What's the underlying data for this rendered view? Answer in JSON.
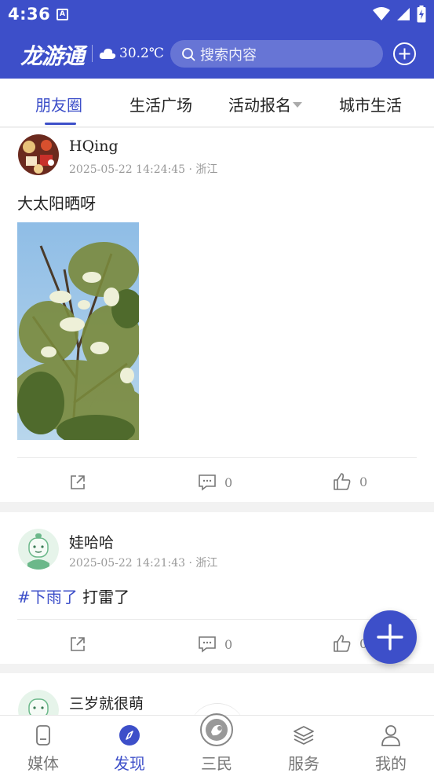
{
  "status": {
    "time": "4:36",
    "badge": "A"
  },
  "appbar": {
    "logo": "龙游通",
    "temperature": "30.2℃",
    "search_placeholder": "搜索内容"
  },
  "tabs": [
    {
      "label": "朋友圈",
      "active": true
    },
    {
      "label": "生活广场"
    },
    {
      "label": "活动报名"
    },
    {
      "label": "城市生活"
    }
  ],
  "posts": [
    {
      "user": "HQing",
      "time": "2025-05-22 14:24:45",
      "location": "浙江",
      "meta": "2025-05-22 14:24:45 · 浙江",
      "text": "大太阳晒呀",
      "comments": "0",
      "likes": "0"
    },
    {
      "user": "娃哈哈",
      "time": "2025-05-22 14:21:43",
      "location": "浙江",
      "meta": "2025-05-22 14:21:43 · 浙江",
      "hashtag": "#下雨了",
      "text": " 打雷了",
      "comments": "0",
      "likes": "0"
    },
    {
      "user": "三岁就很萌"
    }
  ],
  "bottom_nav": [
    {
      "label": "媒体",
      "icon": "document-icon"
    },
    {
      "label": "发现",
      "icon": "compass-icon",
      "active": true
    },
    {
      "label": "三民",
      "icon": "sanmin-icon"
    },
    {
      "label": "服务",
      "icon": "layers-icon"
    },
    {
      "label": "我的",
      "icon": "person-icon"
    }
  ],
  "colors": {
    "brand": "#3d4fc9",
    "text": "#222222",
    "muted": "#999999"
  }
}
